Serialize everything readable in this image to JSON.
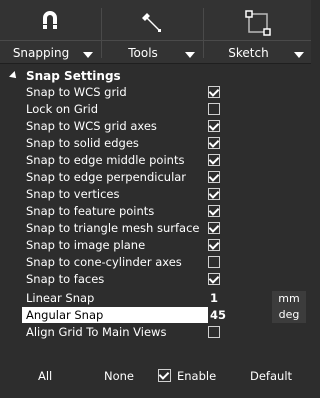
{
  "toolbar": {
    "snapping_label": "Snapping",
    "tools_label": "Tools",
    "sketch_label": "Sketch"
  },
  "panel": {
    "title": "Snap Settings",
    "options": [
      {
        "label": "Snap to WCS grid",
        "checked": true
      },
      {
        "label": "Lock on Grid",
        "checked": false
      },
      {
        "label": "Snap to WCS grid axes",
        "checked": true
      },
      {
        "label": "Snap to solid edges",
        "checked": true
      },
      {
        "label": "Snap to edge middle points",
        "checked": true
      },
      {
        "label": "Snap to edge perpendicular",
        "checked": true
      },
      {
        "label": "Snap to vertices",
        "checked": true
      },
      {
        "label": "Snap to feature points",
        "checked": true
      },
      {
        "label": "Snap to triangle mesh surface",
        "checked": true
      },
      {
        "label": "Snap to image plane",
        "checked": true
      },
      {
        "label": "Snap to cone-cylinder axes",
        "checked": false
      },
      {
        "label": "Snap to faces",
        "checked": true
      }
    ],
    "linear_snap": {
      "label": "Linear Snap",
      "value": "1",
      "unit": "mm"
    },
    "angular_snap": {
      "label": "Angular Snap",
      "value": "45",
      "unit": "deg"
    },
    "align_grid": {
      "label": "Align Grid To Main Views",
      "checked": false
    }
  },
  "footer": {
    "all_label": "All",
    "none_label": "None",
    "enable_label": "Enable",
    "enable_checked": true,
    "default_label": "Default"
  }
}
